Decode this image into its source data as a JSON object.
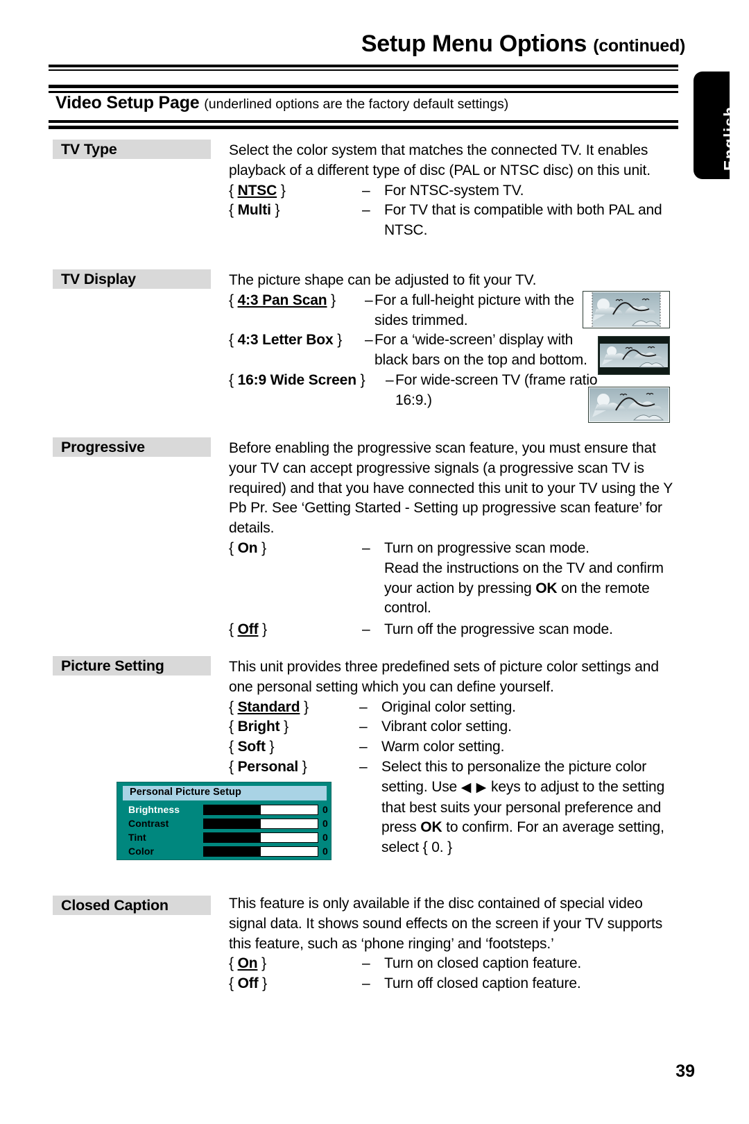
{
  "header": {
    "title": "Setup Menu Options",
    "continued": "(continued)",
    "language_tab": "English"
  },
  "section": {
    "title": "Video Setup Page",
    "note": "(underlined options are the factory default settings)"
  },
  "entries": [
    {
      "label": "TV Type",
      "intro": "Select the color system that matches the connected TV.  It enables playback of a different type of disc (PAL or NTSC disc) on this unit.",
      "options": [
        {
          "open": "{",
          "name": "NTSC",
          "close": "}",
          "underlined": true,
          "dash": "–",
          "desc": "For NTSC-system TV."
        },
        {
          "open": "{",
          "name": "Multi",
          "close": "}",
          "underlined": false,
          "dash": "–",
          "desc": "For TV that is compatible with both PAL and NTSC."
        }
      ]
    },
    {
      "label": "TV Display",
      "intro": "The picture shape can be adjusted to fit your TV.",
      "options": [
        {
          "open": "{",
          "name": "4:3 Pan Scan",
          "close": "}",
          "underlined": true,
          "dash": "–",
          "desc": "For a full-height picture with the sides trimmed."
        },
        {
          "open": "{",
          "name": "4:3 Letter Box",
          "close": "}",
          "underlined": false,
          "dash": "–",
          "desc": "For a ‘wide-screen’ display with black bars on the top and bottom."
        },
        {
          "open": "{",
          "name": "16:9 Wide Screen",
          "close": "}",
          "underlined": false,
          "dash": "–",
          "desc": "For wide-screen TV (frame ratio 16:9.)"
        }
      ],
      "thumbnails": [
        {
          "name": "pan-scan-thumbnail"
        },
        {
          "name": "letter-box-thumbnail"
        },
        {
          "name": "wide-screen-thumbnail"
        }
      ]
    },
    {
      "label": "Progressive",
      "intro": "Before enabling the progressive scan feature, you must ensure that your TV can accept progressive signals (a progressive scan TV is required) and that you have connected this unit to your TV using the Y Pb Pr.  See ‘Getting Started - Setting up progressive scan feature’ for details.",
      "options": [
        {
          "open": "{",
          "name": "On",
          "close": "}",
          "underlined": false,
          "dash": "–",
          "desc": "Turn on progressive scan mode."
        },
        {
          "open": "{",
          "name": "Off",
          "close": "}",
          "underlined": true,
          "dash": "–",
          "desc": "Turn off the progressive scan mode."
        }
      ],
      "on_extra_pre": "Read the instructions on the TV and confirm your action by pressing ",
      "on_extra_key": "OK",
      "on_extra_post": " on the remote control."
    },
    {
      "label": "Picture Setting",
      "intro": "This unit provides three predefined sets of picture color settings and one personal setting which you can define yourself.",
      "options": [
        {
          "open": "{",
          "name": "Standard",
          "close": "}",
          "underlined": true,
          "dash": "–",
          "desc": "Original color setting."
        },
        {
          "open": "{",
          "name": "Bright",
          "close": "}",
          "underlined": false,
          "dash": "–",
          "desc": "Vibrant color setting."
        },
        {
          "open": "{",
          "name": "Soft",
          "close": "}",
          "underlined": false,
          "dash": "–",
          "desc": "Warm color setting."
        },
        {
          "open": "{",
          "name": "Personal",
          "close": "}",
          "underlined": false,
          "dash": "–",
          "desc": ""
        }
      ],
      "personal_desc_1": "Select this to personalize the picture color",
      "personal_desc_2a": "setting. Use ",
      "personal_arrows": "◀ ▶",
      "personal_desc_2b": " keys to adjust to the setting",
      "personal_desc_3": "that best suits your personal preference and",
      "personal_desc_4a": "press ",
      "personal_key": "OK",
      "personal_desc_4b": " to confirm.  For an average setting,",
      "personal_desc_5": "select { 0. }"
    },
    {
      "label": "Closed Caption",
      "intro": "This feature is only available if the disc contained of special video signal data. It shows sound effects on the screen if your TV supports this feature, such as ‘phone ringing’ and ‘footsteps.’",
      "options": [
        {
          "open": "{",
          "name": "On",
          "close": "}",
          "underlined": true,
          "dash": "–",
          "desc": "Turn on closed caption feature."
        },
        {
          "open": "{",
          "name": "Off",
          "close": "}",
          "underlined": false,
          "dash": "–",
          "desc": "Turn off closed caption feature."
        }
      ]
    }
  ],
  "osd": {
    "title": "Personal Picture Setup",
    "rows": [
      {
        "label": "Brightness",
        "value": "0",
        "fill_percent": 50,
        "selected": true
      },
      {
        "label": "Contrast",
        "value": "0",
        "fill_percent": 50,
        "selected": false
      },
      {
        "label": "Tint",
        "value": "0",
        "fill_percent": 50,
        "selected": false
      },
      {
        "label": "Color",
        "value": "0",
        "fill_percent": 50,
        "selected": false
      }
    ],
    "colors": {
      "background": "#00877e",
      "title_bar": "#a9d3e5",
      "bar_fill": "#000000",
      "bar_track": "#ffffff"
    }
  },
  "footer": {
    "page_number": "39"
  }
}
